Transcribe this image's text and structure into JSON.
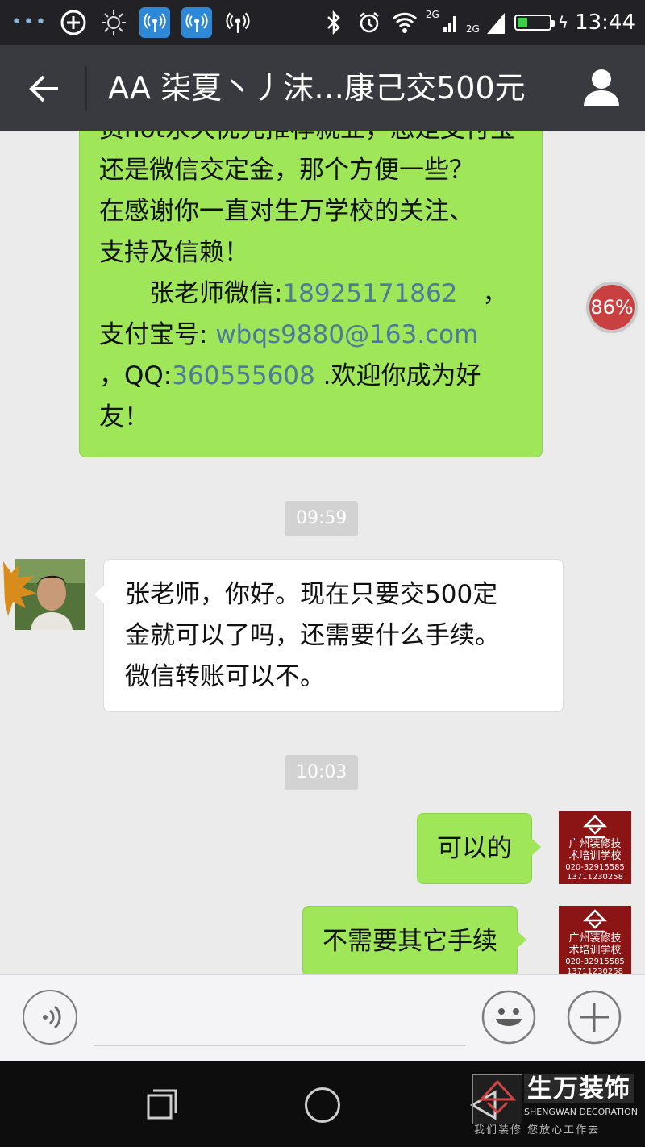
{
  "status_bar": {
    "time": "13:44",
    "network_label_1": "2G",
    "network_label_2": "2G",
    "icons": [
      "more-dots-icon",
      "circle-plus-icon",
      "brightness-icon",
      "wifi-hotspot-icon",
      "wifi-hotspot-icon",
      "wifi-hotspot-icon",
      "bluetooth-icon",
      "alarm-icon",
      "wifi-icon",
      "signal-icon",
      "signal-icon",
      "battery-icon"
    ],
    "battery_level": 0.3
  },
  "header": {
    "title": "AA  柒夏丶丿沫…康己交500元",
    "back_icon": "back-arrow-icon",
    "profile_icon": "person-icon"
  },
  "messages": {
    "long_sent": {
      "line1": "资not永久优先推荐就业，您是支付宝",
      "line2": "还是微信交定金，那个方便一些？",
      "line3": "在感谢你一直对生万学校的关注、",
      "line4": "支持及信赖！",
      "line5_label": "　　张老师微信:",
      "line5_value": "18925171862",
      "line5_tail": "　，",
      "line6_label": "支付宝号: ",
      "line6_value": "wbqs9880@163.com",
      "line7_label": "，QQ:",
      "line7_value": "360555608",
      "line7_tail": " .欢迎你成为好",
      "line8": "友！"
    },
    "time_1": "09:59",
    "received": {
      "line1": "张老师，你好。现在只要交500定",
      "line2": "金就可以了吗，还需要什么手续。",
      "line3": "微信转账可以不。"
    },
    "time_2": "10:03",
    "sent_1": "可以的",
    "sent_2": "不需要其它手续"
  },
  "school_avatar": {
    "line1": "广州装修技",
    "line2": "术培训学校",
    "line3": "020-32915585",
    "line4": "13711230258"
  },
  "float_badge": {
    "text": "86%"
  },
  "input_bar": {
    "voice_icon": "voice-icon",
    "emoji_icon": "emoji-icon",
    "plus_icon": "plus-icon"
  },
  "watermark": {
    "name": "生万装饰",
    "english": "SHENGWAN DECORATION",
    "slogan": "我们装修 您放心工作去"
  },
  "colors": {
    "sent_bubble": "#9fe658",
    "received_bubble": "#ffffff",
    "header_bg": "#393a3f",
    "link_blue": "#4d7a9c",
    "school_red": "#8b1414"
  }
}
